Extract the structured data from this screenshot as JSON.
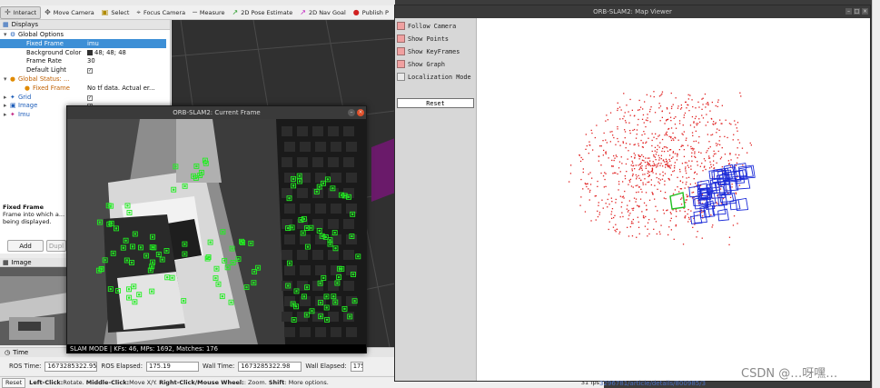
{
  "rviz": {
    "toolbar": [
      {
        "label": "Interact",
        "icon": "interact-icon",
        "glyph": "✛",
        "color": "#555",
        "active": true
      },
      {
        "label": "Move Camera",
        "icon": "move-camera-icon",
        "glyph": "✥",
        "color": "#555",
        "active": false
      },
      {
        "label": "Select",
        "icon": "select-icon",
        "glyph": "▣",
        "color": "#b08a00",
        "active": false
      },
      {
        "label": "Focus Camera",
        "icon": "focus-camera-icon",
        "glyph": "⌖",
        "color": "#555",
        "active": false
      },
      {
        "label": "Measure",
        "icon": "measure-icon",
        "glyph": "─",
        "color": "#555",
        "active": false
      },
      {
        "label": "2D Pose Estimate",
        "icon": "pose-estimate-icon",
        "glyph": "↗",
        "color": "#2a9d2a",
        "active": false
      },
      {
        "label": "2D Nav Goal",
        "icon": "nav-goal-icon",
        "glyph": "↗",
        "color": "#c020c0",
        "active": false
      },
      {
        "label": "Publish P",
        "icon": "publish-point-icon",
        "glyph": "●",
        "color": "#d02020",
        "active": false
      }
    ],
    "displays": {
      "title": "Displays",
      "rows": [
        {
          "indent": 4,
          "expander": "▾",
          "label": "Global Options",
          "value": "",
          "style": "",
          "sel": false,
          "icon": "⚙",
          "iconColor": "#1a5bb8",
          "name": "global-options"
        },
        {
          "indent": 20,
          "expander": "",
          "label": "Fixed Frame",
          "value": "imu",
          "style": "",
          "sel": true,
          "icon": "",
          "iconColor": "",
          "name": "fixed-frame"
        },
        {
          "indent": 20,
          "expander": "",
          "label": "Background Color",
          "value": "48; 48; 48",
          "style": "swatch",
          "sel": false,
          "icon": "",
          "iconColor": "",
          "name": "background-color"
        },
        {
          "indent": 20,
          "expander": "",
          "label": "Frame Rate",
          "value": "30",
          "style": "",
          "sel": false,
          "icon": "",
          "iconColor": "",
          "name": "frame-rate"
        },
        {
          "indent": 20,
          "expander": "",
          "label": "Default Light",
          "value": "✓",
          "style": "check",
          "sel": false,
          "icon": "",
          "iconColor": "",
          "name": "default-light"
        },
        {
          "indent": 4,
          "expander": "▾",
          "label": "Global Status: ...",
          "value": "",
          "style": "orange",
          "sel": false,
          "icon": "●",
          "iconColor": "#e08a00",
          "name": "global-status"
        },
        {
          "indent": 20,
          "expander": "",
          "label": "Fixed Frame",
          "value": "No tf data.  Actual er...",
          "style": "orange",
          "sel": false,
          "icon": "●",
          "iconColor": "#e08a00",
          "name": "fixed-frame-status"
        },
        {
          "indent": 4,
          "expander": "▸",
          "label": "Grid",
          "value": "✓",
          "style": "blue-check",
          "sel": false,
          "icon": "✦",
          "iconColor": "#1a5bb8",
          "name": "grid"
        },
        {
          "indent": 4,
          "expander": "▸",
          "label": "Image",
          "value": "✓",
          "style": "blue-check",
          "sel": false,
          "icon": "▣",
          "iconColor": "#1a5bb8",
          "name": "image"
        },
        {
          "indent": 4,
          "expander": "▸",
          "label": "Imu",
          "value": "✓",
          "style": "blue-check",
          "sel": false,
          "icon": "✦",
          "iconColor": "#c02080",
          "name": "imu"
        }
      ]
    },
    "description": {
      "title": "Fixed Frame",
      "text": "Frame into which a... being displayed."
    },
    "add_button": "Add",
    "duplicate_button": "Dupl",
    "image_panel_title": "Image",
    "time": {
      "title": "Time",
      "ros_time_label": "ROS Time:",
      "ros_time": "1673285322.95",
      "ros_elapsed_label": "ROS Elapsed:",
      "ros_elapsed": "175.19",
      "wall_time_label": "Wall Time:",
      "wall_time": "1673285322.98",
      "wall_elapsed_label": "Wall Elapsed:",
      "wall_elapsed": "175"
    },
    "status": {
      "reset": "Reset",
      "left_click": "Left-Click:",
      "left_click_action": " Rotate. ",
      "middle_click": "Middle-Click:",
      "middle_click_action": " Move X/Y. ",
      "right_click": "Right-Click/Mouse Wheel:",
      "right_click_action": ": Zoom. ",
      "shift": "Shift",
      "shift_action": ": More options."
    },
    "fps": "31 fps"
  },
  "current_frame": {
    "title": "ORB-SLAM2: Current Frame",
    "status": "SLAM MODE |  KFs: 46, MPs: 1692, Matches: 176"
  },
  "map_viewer": {
    "title": "ORB-SLAM2: Map Viewer",
    "options": [
      {
        "label": "Follow Camera",
        "checked": true
      },
      {
        "label": "Show Points",
        "checked": true
      },
      {
        "label": "Show KeyFrames",
        "checked": true
      },
      {
        "label": "Show Graph",
        "checked": true
      },
      {
        "label": "Localization Mode",
        "checked": false
      }
    ],
    "reset": "Reset"
  },
  "footer": {
    "link": "3296781/article/details/800985/3",
    "watermark": "CSDN @…呀嘿…"
  },
  "colors": {
    "map_points": "#e02020",
    "keyframes": "#1a2ad8",
    "current_camera": "#20c020",
    "features": "#22ee22"
  }
}
